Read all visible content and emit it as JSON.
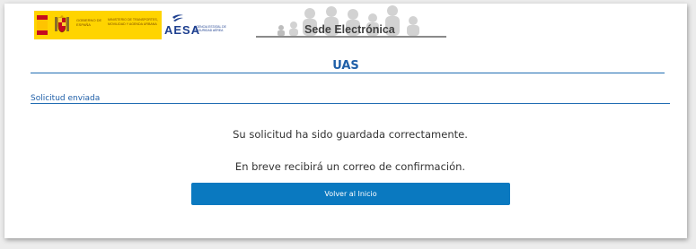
{
  "header": {
    "gov_text": "Gobierno de España",
    "ministry_text": "Ministerio de Transportes, Movilidad y Agenda Urbana",
    "aesa_word": "AESA",
    "aesa_sub": "Agencia Estatal de Seguridad Aérea",
    "sede_title": "Sede Electrónica"
  },
  "main": {
    "section_title": "UAS",
    "subsection_title": "Solicitud enviada",
    "message_saved": "Su solicitud ha sido guardada correctamente.",
    "message_confirmation": "En breve recibirá un correo de confirmación.",
    "home_button_label": "Volver al Inicio"
  },
  "colors": {
    "accent_blue": "#1f5fa8",
    "button_blue": "#0a79c0",
    "gov_yellow": "#ffd400",
    "flag_red": "#c60b1e"
  },
  "icons": {
    "flag": "spain-flag-icon",
    "shield": "coat-of-arms-icon",
    "aesa": "aesa-wing-icon",
    "banner": "people-silhouettes-icon"
  }
}
